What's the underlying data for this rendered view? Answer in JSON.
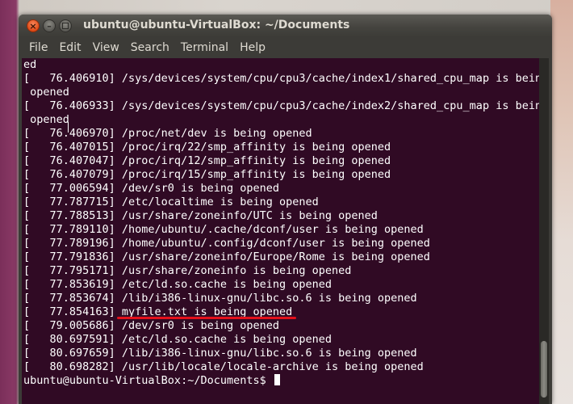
{
  "window": {
    "title": "ubuntu@ubuntu-VirtualBox: ~/Documents",
    "close_glyph": "×",
    "min_glyph": "–"
  },
  "menubar": {
    "items": [
      "File",
      "Edit",
      "View",
      "Search",
      "Terminal",
      "Help"
    ]
  },
  "terminal": {
    "lines": [
      "ed",
      "[   76.406910] /sys/devices/system/cpu/cpu3/cache/index1/shared_cpu_map is being",
      " opened",
      "[   76.406933] /sys/devices/system/cpu/cpu3/cache/index2/shared_cpu_map is being",
      " opened",
      "[   76.406970] /proc/net/dev is being opened",
      "[   76.407015] /proc/irq/22/smp_affinity is being opened",
      "[   76.407047] /proc/irq/12/smp_affinity is being opened",
      "[   76.407079] /proc/irq/15/smp_affinity is being opened",
      "[   77.006594] /dev/sr0 is being opened",
      "[   77.787715] /etc/localtime is being opened",
      "[   77.788513] /usr/share/zoneinfo/UTC is being opened",
      "[   77.789110] /home/ubuntu/.cache/dconf/user is being opened",
      "[   77.789196] /home/ubuntu/.config/dconf/user is being opened",
      "[   77.791836] /usr/share/zoneinfo/Europe/Rome is being opened",
      "[   77.795171] /usr/share/zoneinfo is being opened",
      "[   77.853619] /etc/ld.so.cache is being opened",
      "[   77.853674] /lib/i386-linux-gnu/libc.so.6 is being opened",
      "[   77.854163] myfile.txt is being opened",
      "[   79.005686] /dev/sr0 is being opened",
      "[   80.697591] /etc/ld.so.cache is being opened",
      "[   80.697659] /lib/i386-linux-gnu/libc.so.6 is being opened",
      "[   80.698282] /usr/lib/locale/locale-archive is being opened"
    ],
    "prompt": "ubuntu@ubuntu-VirtualBox:~/Documents$ "
  },
  "colors": {
    "terminal_bg": "#300a24",
    "terminal_fg": "#ffffff",
    "highlight_underline": "#e3111b",
    "chrome": "#3c3b37"
  }
}
